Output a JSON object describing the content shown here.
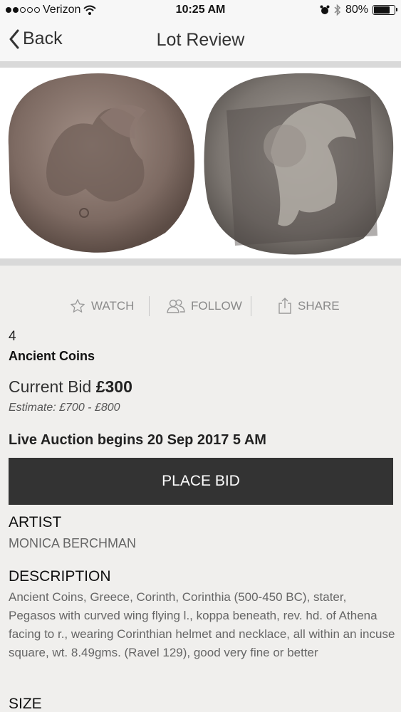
{
  "status": {
    "carrier": "Verizon",
    "time": "10:25 AM",
    "battery": "80%",
    "battery_level": 0.8
  },
  "nav": {
    "back_label": "Back",
    "title": "Lot Review"
  },
  "actions": {
    "watch": "WATCH",
    "follow": "FOLLOW",
    "share": "SHARE"
  },
  "lot": {
    "number": "4",
    "category": "Ancient Coins",
    "current_bid_label": "Current Bid",
    "current_bid_value": "£300",
    "estimate": "Estimate: £700 - £800",
    "auction_begins": "Live Auction begins 20 Sep 2017 5 AM"
  },
  "place_bid_label": "PLACE BID",
  "artist": {
    "heading": "ARTIST",
    "name": "MONICA BERCHMAN"
  },
  "description": {
    "heading": "DESCRIPTION",
    "text": "Ancient Coins, Greece, Corinth, Corinthia (500-450 BC), stater, Pegasos with curved wing flying l., koppa beneath, rev. hd. of Athena facing to r., wearing Corinthian helmet and necklace, all within an incuse square, wt. 8.49gms. (Ravel 129), good very fine or better"
  },
  "size": {
    "heading": "SIZE"
  }
}
